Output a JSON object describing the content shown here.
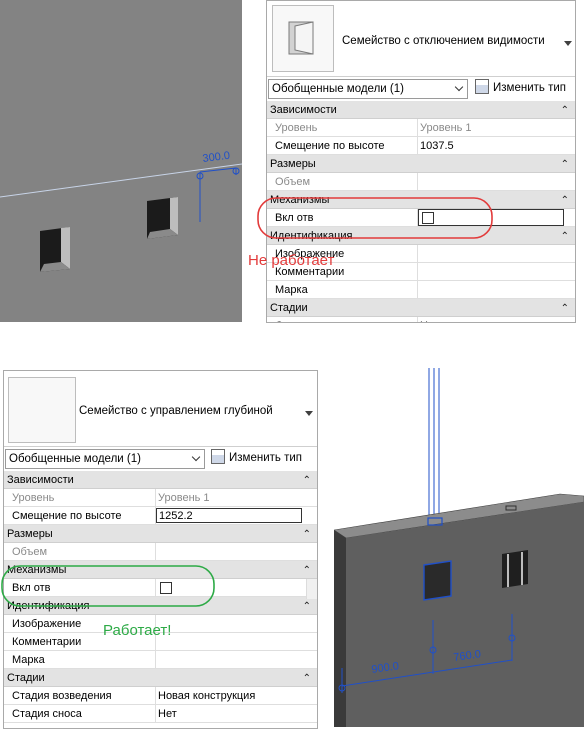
{
  "top_panel": {
    "family_name": "Семейство с отключением видимости",
    "type_selector": "Обобщенные модели (1)",
    "edit_type_label": "Изменить тип",
    "rows": [
      {
        "kind": "group",
        "label": "Зависимости"
      },
      {
        "kind": "prop",
        "label": "Уровень",
        "value": "Уровень 1",
        "dim": true
      },
      {
        "kind": "prop",
        "label": "Смещение по высоте",
        "value": "1037.5"
      },
      {
        "kind": "group",
        "label": "Размеры"
      },
      {
        "kind": "prop",
        "label": "Объем",
        "value": "",
        "dim": true
      },
      {
        "kind": "group",
        "label": "Механизмы"
      },
      {
        "kind": "prop",
        "label": "Вкл отв",
        "value": "",
        "checkbox": true
      },
      {
        "kind": "group",
        "label": "Идентификация"
      },
      {
        "kind": "prop",
        "label": "Изображение",
        "value": ""
      },
      {
        "kind": "prop",
        "label": "Комментарии",
        "value": ""
      },
      {
        "kind": "prop",
        "label": "Марка",
        "value": ""
      },
      {
        "kind": "group",
        "label": "Стадии"
      },
      {
        "kind": "prop",
        "label": "Стадия возведения",
        "value": "Новая конструкция"
      }
    ],
    "annotation": "Не работает"
  },
  "top_view": {
    "dimension": "300.0"
  },
  "bottom_panel": {
    "family_name": "Семейство с управлением глубиной",
    "type_selector": "Обобщенные модели (1)",
    "edit_type_label": "Изменить тип",
    "rows": [
      {
        "kind": "group",
        "label": "Зависимости"
      },
      {
        "kind": "prop",
        "label": "Уровень",
        "value": "Уровень 1",
        "dim": true
      },
      {
        "kind": "prop",
        "label": "Смещение по высоте",
        "value": "1252.2",
        "input": true
      },
      {
        "kind": "group",
        "label": "Размеры"
      },
      {
        "kind": "prop",
        "label": "Объем",
        "value": "",
        "dim": true
      },
      {
        "kind": "group",
        "label": "Механизмы"
      },
      {
        "kind": "prop",
        "label": "Вкл отв",
        "value": "",
        "checkbox": true
      },
      {
        "kind": "group",
        "label": "Идентификация"
      },
      {
        "kind": "prop",
        "label": "Изображение",
        "value": ""
      },
      {
        "kind": "prop",
        "label": "Комментарии",
        "value": ""
      },
      {
        "kind": "prop",
        "label": "Марка",
        "value": ""
      },
      {
        "kind": "group",
        "label": "Стадии"
      },
      {
        "kind": "prop",
        "label": "Стадия возведения",
        "value": "Новая конструкция"
      },
      {
        "kind": "prop",
        "label": "Стадия сноса",
        "value": "Нет"
      }
    ],
    "annotation": "Работает!"
  },
  "bottom_view": {
    "dimension_left": "900.0",
    "dimension_right": "760.0"
  },
  "colors": {
    "viewport_gray": "#838383",
    "annotation_red": "#e23b3b",
    "annotation_green": "#2daa46",
    "dimension_blue": "#2050c8"
  }
}
